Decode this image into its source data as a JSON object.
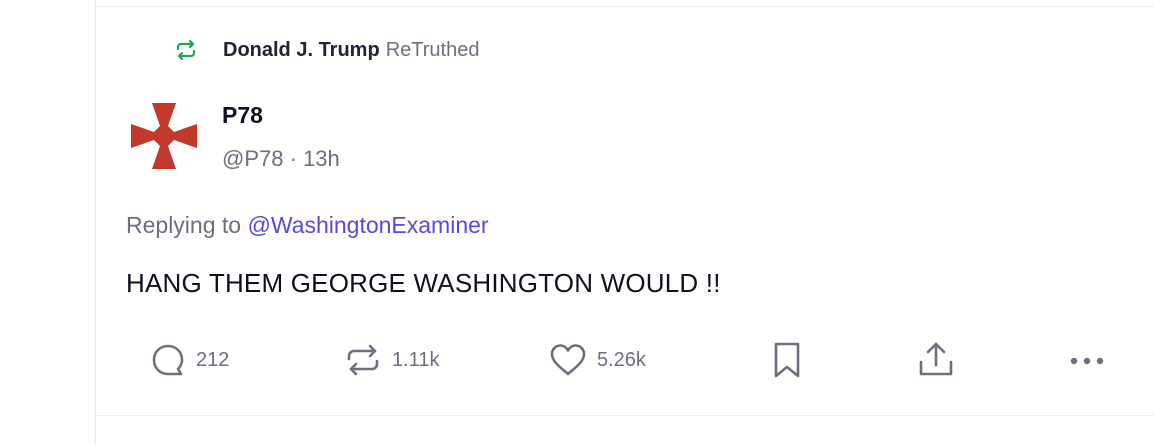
{
  "retruth_banner": {
    "name": "Donald J. Trump",
    "verb": "ReTruthed",
    "icon": "retruth-icon",
    "color": "#1ba84e"
  },
  "post": {
    "display_name": "P78",
    "handle": "@P78",
    "separator": "·",
    "age": "13h",
    "replying_prefix": "Replying to",
    "replying_to": "@WashingtonExaminer",
    "text": "HANG THEM GEORGE WASHINGTON WOULD !!",
    "avatar": "red-cross-pattee-avatar"
  },
  "actions": {
    "reply_count": "212",
    "retruth_count": "1.11k",
    "like_count": "5.26k"
  },
  "colors": {
    "mention": "#5448ee",
    "muted_text": "#6f6d80",
    "icon": "#6f6d80",
    "avatar_red": "#c0392b"
  }
}
